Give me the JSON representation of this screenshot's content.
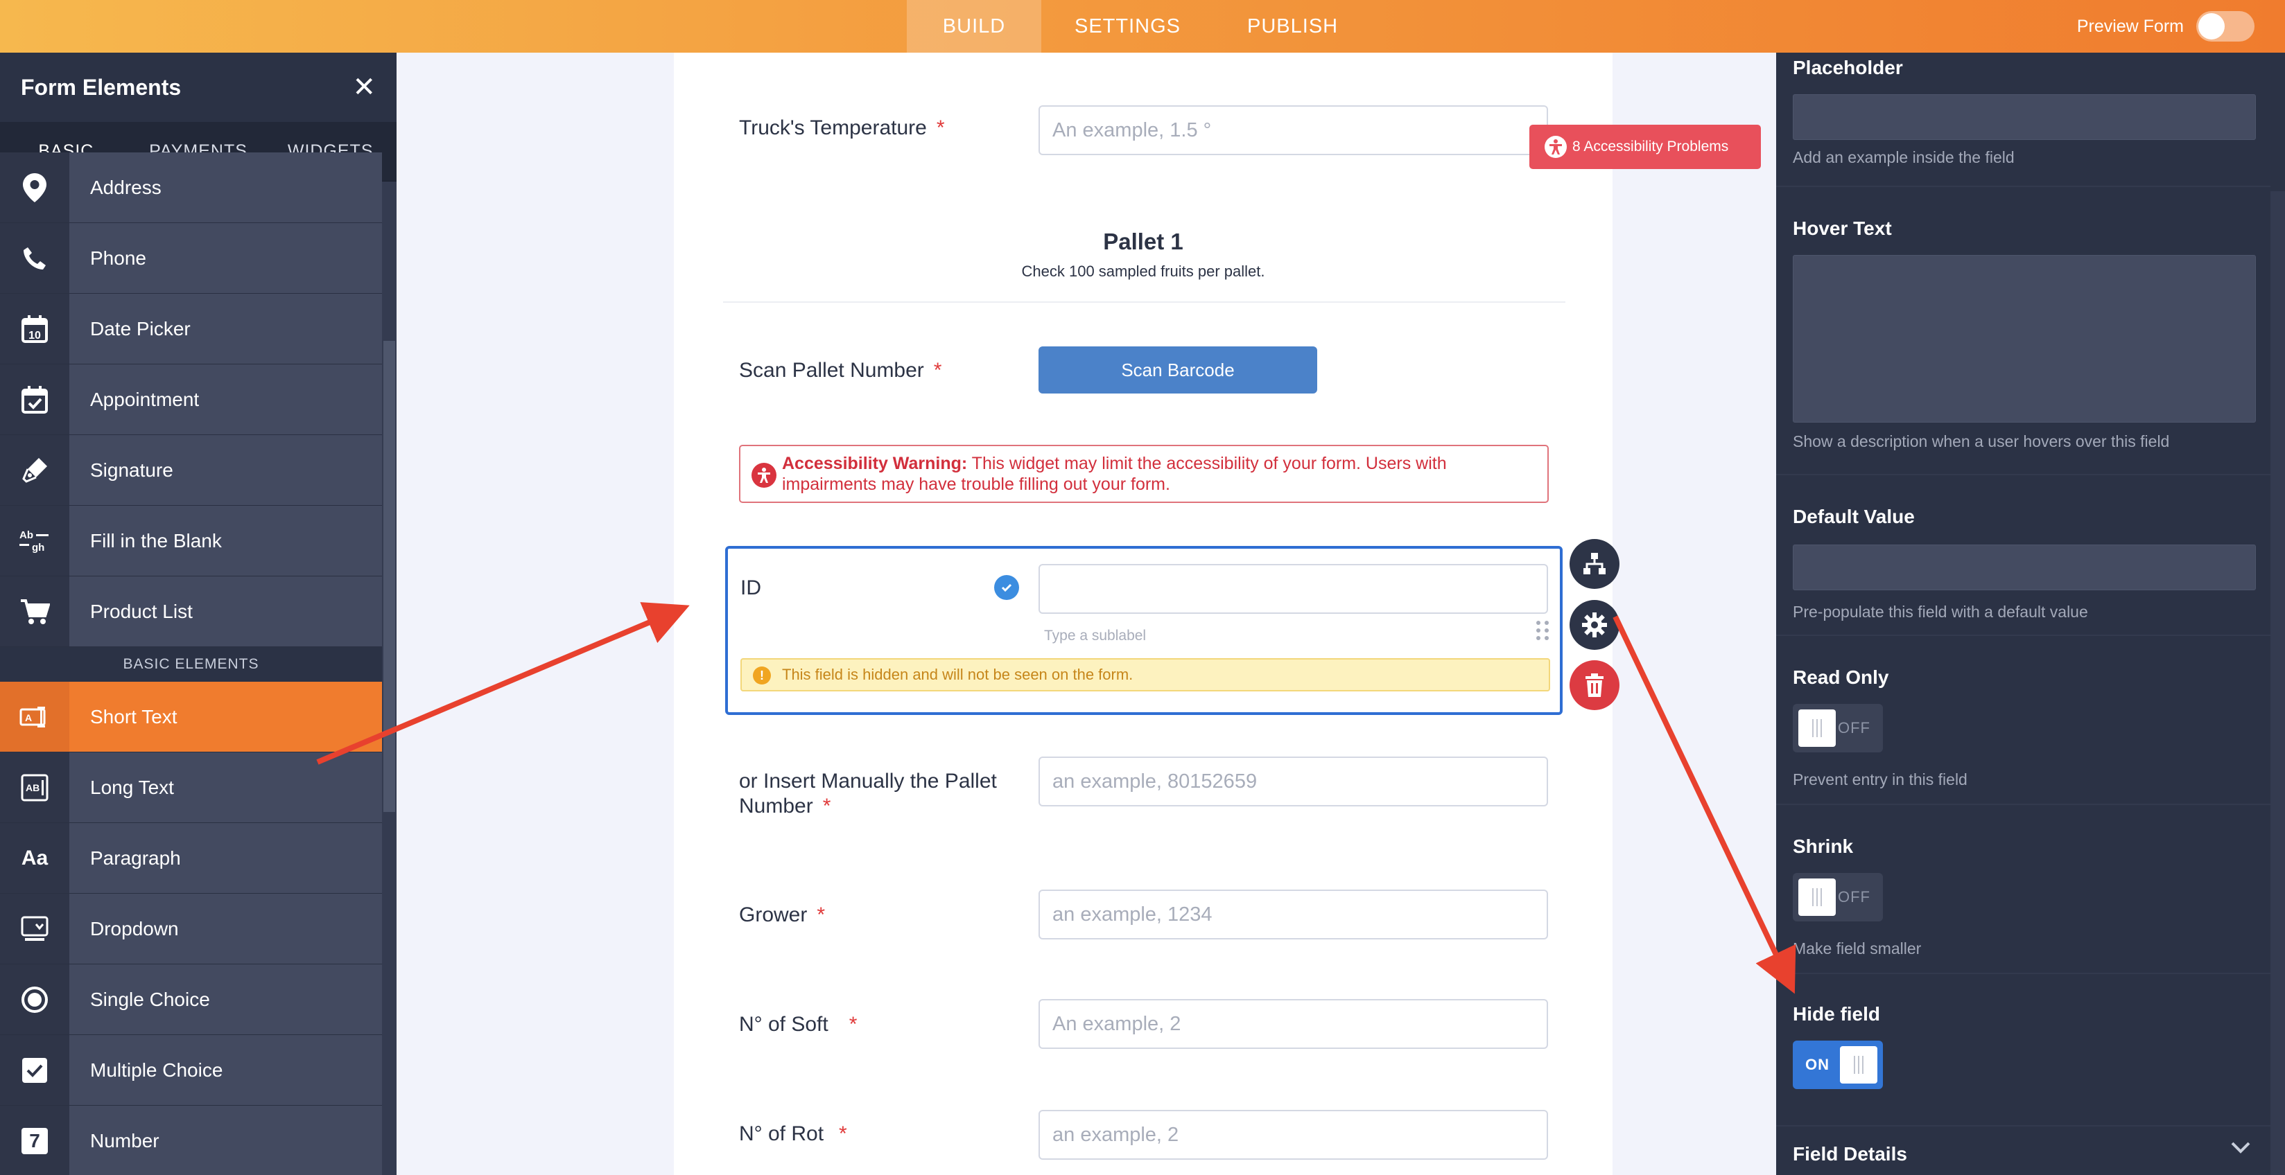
{
  "topbar": {
    "tabs": [
      "BUILD",
      "SETTINGS",
      "PUBLISH"
    ],
    "active_tab": "BUILD",
    "preview_label": "Preview Form",
    "preview_on": false,
    "accent": "#f07c2e"
  },
  "left_panel": {
    "title": "Form Elements",
    "tabs": [
      "BASIC",
      "PAYMENTS",
      "WIDGETS"
    ],
    "items_top": [
      {
        "label": "Address",
        "icon": "location-pin-icon"
      },
      {
        "label": "Phone",
        "icon": "phone-icon"
      },
      {
        "label": "Date Picker",
        "icon": "calendar-10-icon"
      },
      {
        "label": "Appointment",
        "icon": "calendar-check-icon"
      },
      {
        "label": "Signature",
        "icon": "pen-icon"
      },
      {
        "label": "Fill in the Blank",
        "icon": "fill-blank-icon"
      },
      {
        "label": "Product List",
        "icon": "cart-icon"
      }
    ],
    "section_label": "BASIC ELEMENTS",
    "items_bottom": [
      {
        "label": "Short Text",
        "icon": "short-text-icon"
      },
      {
        "label": "Long Text",
        "icon": "long-text-icon"
      },
      {
        "label": "Paragraph",
        "icon": "paragraph-icon"
      },
      {
        "label": "Dropdown",
        "icon": "dropdown-icon"
      },
      {
        "label": "Single Choice",
        "icon": "radio-icon"
      },
      {
        "label": "Multiple Choice",
        "icon": "checkbox-icon"
      },
      {
        "label": "Number",
        "icon": "number-icon"
      }
    ],
    "paragraph_glyph": "Aa",
    "number_glyph": "7"
  },
  "form": {
    "truck_temp": {
      "label": "Truck's Temperature",
      "placeholder": "An example, 1.5 °"
    },
    "accessibility_problems": "8 Accessibility Problems",
    "pallet_title": "Pallet 1",
    "pallet_sub": "Check 100 sampled fruits per pallet.",
    "scan": {
      "label": "Scan Pallet Number",
      "button": "Scan Barcode"
    },
    "warning": {
      "title": "Accessibility Warning:",
      "text": " This widget may limit the accessibility of your form. Users with impairments may have trouble filling out your form."
    },
    "id_field": {
      "label": "ID",
      "sublabel": "Type a sublabel",
      "hidden_note": "This field is hidden and will not be seen on the form."
    },
    "insert_manually": {
      "label_line1": "or Insert Manually the Pallet",
      "label_line2": "Number",
      "placeholder": "an example, 80152659"
    },
    "grower": {
      "label": "Grower",
      "placeholder": "an example, 1234"
    },
    "soft": {
      "label": "N° of Soft",
      "placeholder": "An example, 2"
    },
    "rot": {
      "label": "N° of Rot",
      "placeholder": "an example, 2"
    },
    "required_mark": "*"
  },
  "right_panel": {
    "placeholder": {
      "label": "Placeholder",
      "help": "Add an example inside the field",
      "value": ""
    },
    "hover_text": {
      "label": "Hover Text",
      "help": "Show a description when a user hovers over this field",
      "value": ""
    },
    "default_value": {
      "label": "Default Value",
      "help": "Pre-populate this field with a default value",
      "value": ""
    },
    "read_only": {
      "label": "Read Only",
      "state": "OFF",
      "help": "Prevent entry in this field"
    },
    "shrink": {
      "label": "Shrink",
      "state": "OFF",
      "help": "Make field smaller"
    },
    "hide_field": {
      "label": "Hide field",
      "state": "ON"
    },
    "field_details": {
      "label": "Field Details"
    }
  }
}
